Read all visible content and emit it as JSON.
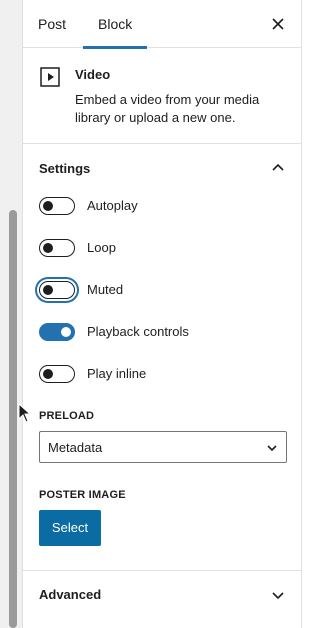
{
  "tabs": {
    "post_label": "Post",
    "block_label": "Block",
    "active": "Block"
  },
  "block_card": {
    "title": "Video",
    "description": "Embed a video from your media library or upload a new one.",
    "icon": "video-icon"
  },
  "settings": {
    "title": "Settings",
    "expanded": true,
    "toggles": [
      {
        "label": "Autoplay",
        "checked": false
      },
      {
        "label": "Loop",
        "checked": false
      },
      {
        "label": "Muted",
        "checked": false,
        "focused": true
      },
      {
        "label": "Playback controls",
        "checked": true
      },
      {
        "label": "Play inline",
        "checked": false
      }
    ],
    "preload": {
      "label": "PRELOAD",
      "value": "Metadata"
    },
    "poster": {
      "label": "POSTER IMAGE",
      "button_label": "Select"
    }
  },
  "advanced": {
    "title": "Advanced",
    "expanded": false
  },
  "colors": {
    "accent": "#2271b1",
    "button": "#0a6ca3",
    "text": "#1e1e1e",
    "border": "#e0e0e0"
  }
}
